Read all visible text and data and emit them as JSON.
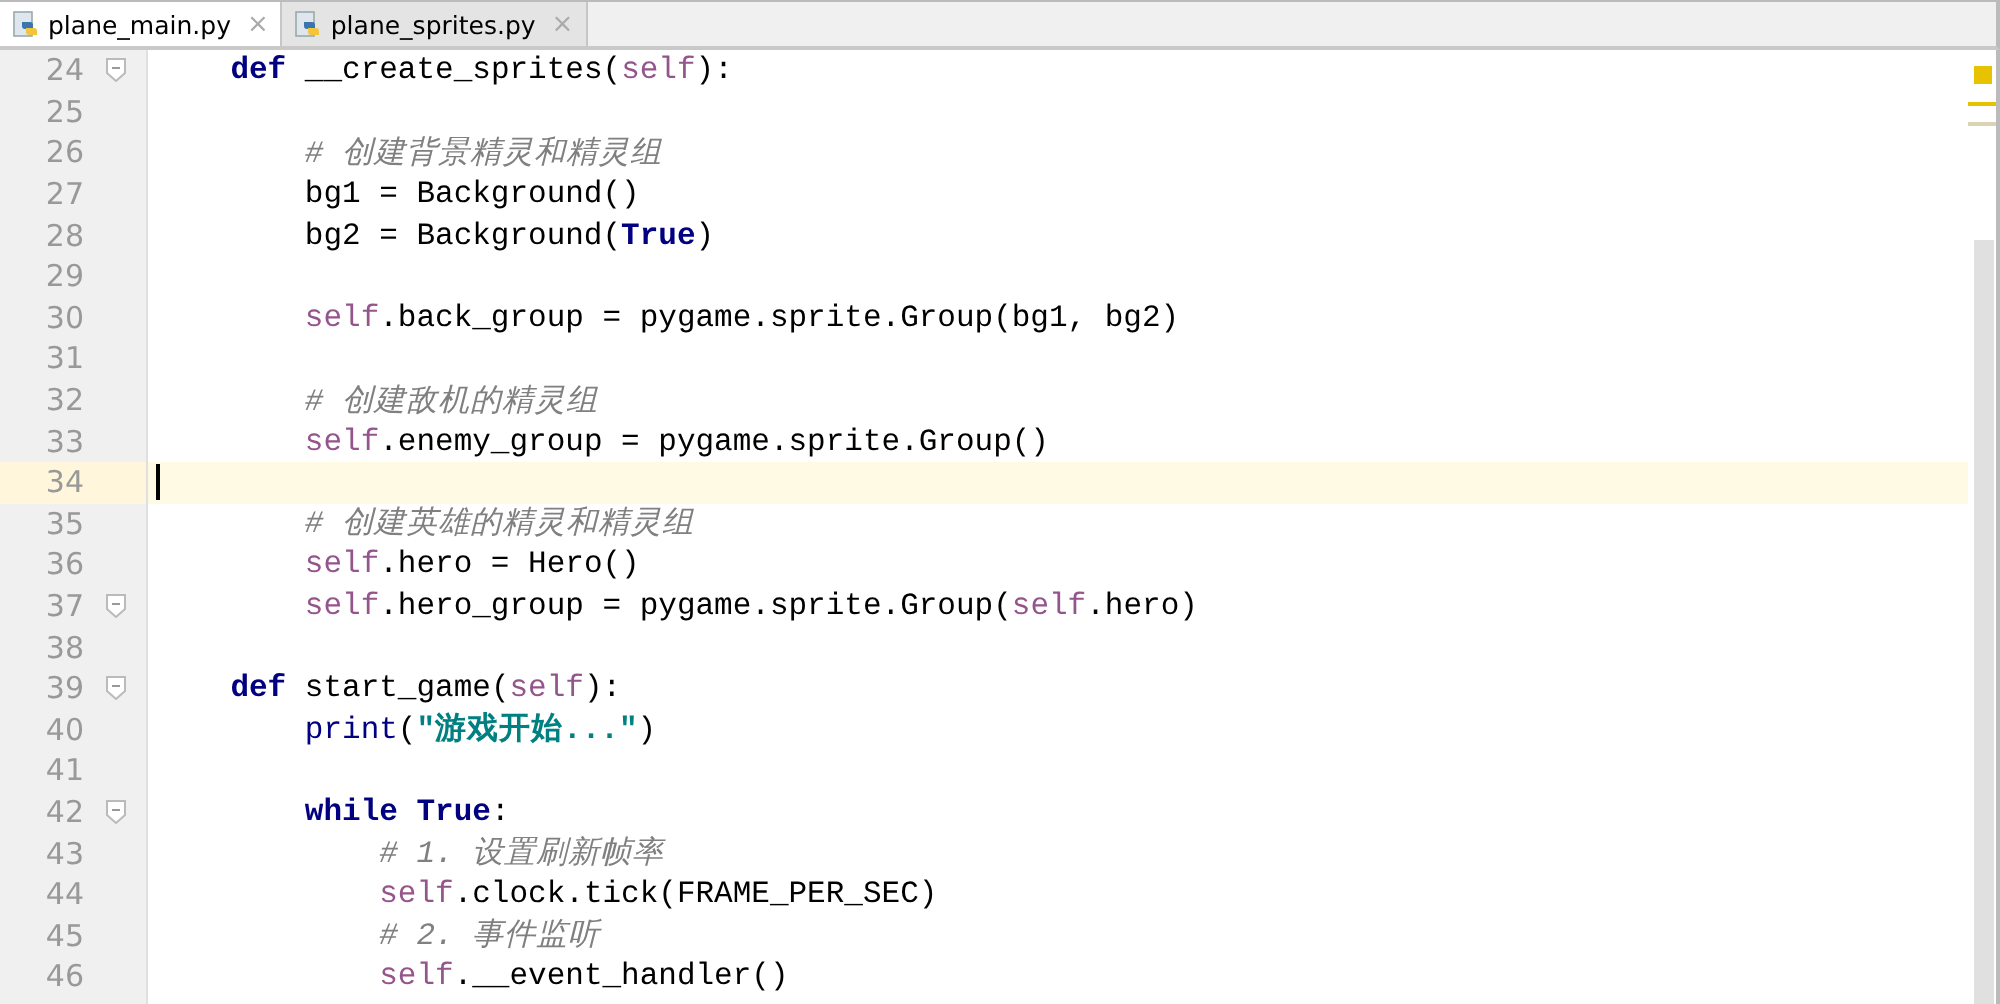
{
  "tabs": [
    {
      "label": "plane_main.py",
      "close": "×",
      "selected": true
    },
    {
      "label": "plane_sprites.py",
      "close": "×",
      "selected": false
    }
  ],
  "editor": {
    "lines": [
      {
        "number": "24",
        "fold": true,
        "current": false,
        "tokens": [
          {
            "kind": "kw",
            "text": "    def"
          },
          {
            "kind": "plain",
            "text": " __create_sprites("
          },
          {
            "kind": "self",
            "text": "self"
          },
          {
            "kind": "plain",
            "text": "):"
          }
        ]
      },
      {
        "number": "25",
        "fold": false,
        "current": false
      },
      {
        "number": "26",
        "fold": false,
        "current": false,
        "tokens": [
          {
            "kind": "comment",
            "text": "        # 创建背景精灵和精灵组"
          }
        ]
      },
      {
        "number": "27",
        "fold": false,
        "current": false,
        "tokens": [
          {
            "kind": "plain",
            "text": "        bg1 = Background()"
          }
        ]
      },
      {
        "number": "28",
        "fold": false,
        "current": false,
        "tokens": [
          {
            "kind": "plain",
            "text": "        bg2 = Background("
          },
          {
            "kind": "kw",
            "text": "True"
          },
          {
            "kind": "plain",
            "text": ")"
          }
        ]
      },
      {
        "number": "29",
        "fold": false,
        "current": false
      },
      {
        "number": "30",
        "fold": false,
        "current": false,
        "tokens": [
          {
            "kind": "self",
            "text": "        self"
          },
          {
            "kind": "plain",
            "text": ".back_group = pygame.sprite.Group(bg1, bg2)"
          }
        ]
      },
      {
        "number": "31",
        "fold": false,
        "current": false
      },
      {
        "number": "32",
        "fold": false,
        "current": false,
        "tokens": [
          {
            "kind": "comment",
            "text": "        # 创建敌机的精灵组"
          }
        ]
      },
      {
        "number": "33",
        "fold": false,
        "current": false,
        "tokens": [
          {
            "kind": "self",
            "text": "        self"
          },
          {
            "kind": "plain",
            "text": ".enemy_group = pygame.sprite.Group()"
          }
        ]
      },
      {
        "number": "34",
        "fold": false,
        "current": true
      },
      {
        "number": "35",
        "fold": false,
        "current": false,
        "tokens": [
          {
            "kind": "comment",
            "text": "        # 创建英雄的精灵和精灵组"
          }
        ]
      },
      {
        "number": "36",
        "fold": false,
        "current": false,
        "tokens": [
          {
            "kind": "self",
            "text": "        self"
          },
          {
            "kind": "plain",
            "text": ".hero = Hero()"
          }
        ]
      },
      {
        "number": "37",
        "fold": true,
        "current": false,
        "tokens": [
          {
            "kind": "self",
            "text": "        self"
          },
          {
            "kind": "plain",
            "text": ".hero_group = pygame.sprite.Group("
          },
          {
            "kind": "self",
            "text": "self"
          },
          {
            "kind": "plain",
            "text": ".hero)"
          }
        ]
      },
      {
        "number": "38",
        "fold": false,
        "current": false
      },
      {
        "number": "39",
        "fold": true,
        "current": false,
        "tokens": [
          {
            "kind": "kw",
            "text": "    def"
          },
          {
            "kind": "plain",
            "text": " start_game("
          },
          {
            "kind": "self",
            "text": "self"
          },
          {
            "kind": "plain",
            "text": "):"
          }
        ]
      },
      {
        "number": "40",
        "fold": false,
        "current": false,
        "tokens": [
          {
            "kind": "builtin",
            "text": "        print"
          },
          {
            "kind": "plain",
            "text": "("
          },
          {
            "kind": "string",
            "text": "\"游戏开始...\""
          },
          {
            "kind": "plain",
            "text": ")"
          }
        ]
      },
      {
        "number": "41",
        "fold": false,
        "current": false
      },
      {
        "number": "42",
        "fold": true,
        "current": false,
        "tokens": [
          {
            "kind": "kw",
            "text": "        while True"
          },
          {
            "kind": "plain",
            "text": ":"
          }
        ]
      },
      {
        "number": "43",
        "fold": false,
        "current": false,
        "tokens": [
          {
            "kind": "comment",
            "text": "            # 1. 设置刷新帧率"
          }
        ]
      },
      {
        "number": "44",
        "fold": false,
        "current": false,
        "tokens": [
          {
            "kind": "self",
            "text": "            self"
          },
          {
            "kind": "plain",
            "text": ".clock.tick(FRAME_PER_SEC)"
          }
        ]
      },
      {
        "number": "45",
        "fold": false,
        "current": false,
        "tokens": [
          {
            "kind": "comment",
            "text": "            # 2. 事件监听"
          }
        ]
      },
      {
        "number": "46",
        "fold": false,
        "current": false,
        "tokens": [
          {
            "kind": "self",
            "text": "            self"
          },
          {
            "kind": "plain",
            "text": ".__event_handler()"
          }
        ]
      }
    ]
  }
}
